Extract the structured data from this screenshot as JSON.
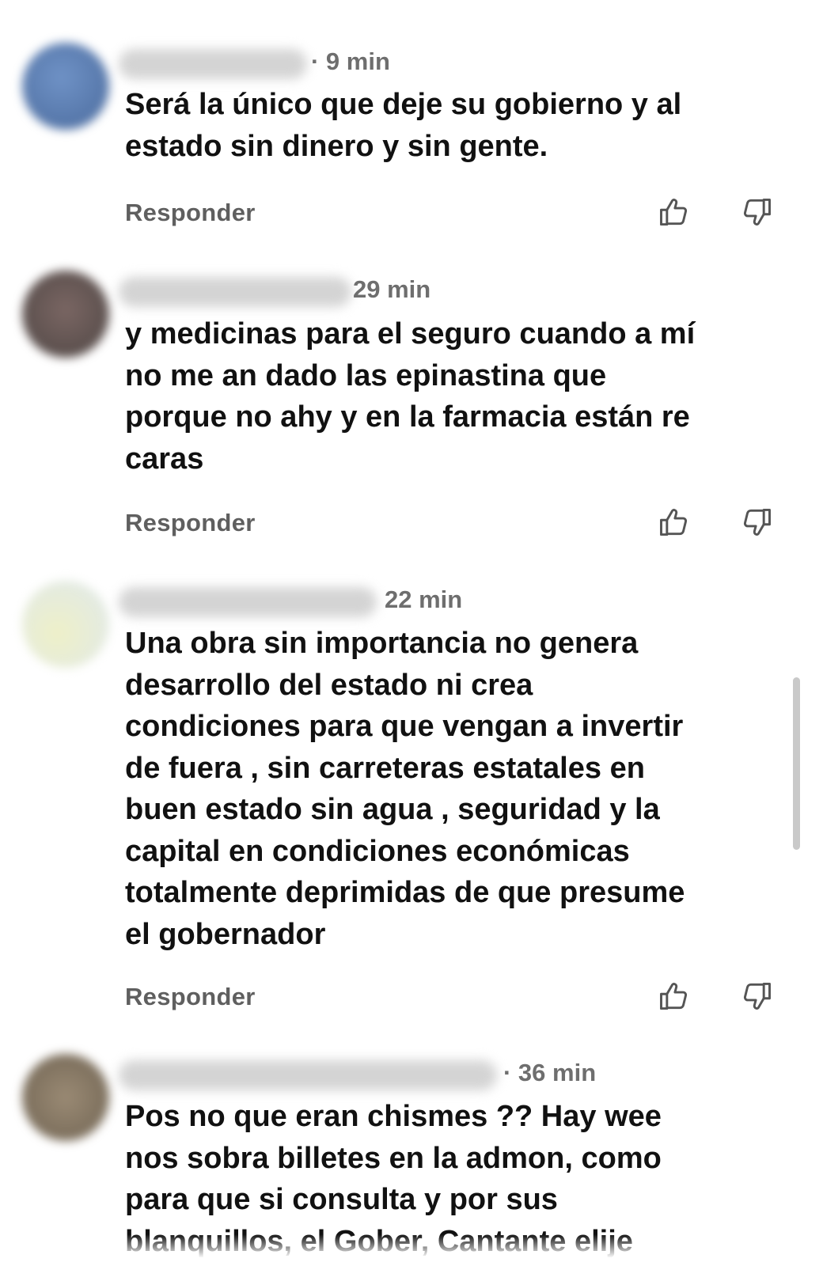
{
  "comments": [
    {
      "time": "· 9 min",
      "lines": [
        "Será la único que deje su gobierno y al",
        "estado sin dinero y sin gente."
      ],
      "reply_label": "Responder",
      "avatar_color": "#5b7fb4"
    },
    {
      "time": "29 min",
      "lines": [
        "y medicinas para el seguro cuando a mí",
        "no me an dado las epinastina que",
        "porque no ahy y en la farmacia están re",
        "caras"
      ],
      "reply_label": "Responder",
      "avatar_color": "#6a5a58"
    },
    {
      "time": "22 min",
      "lines": [
        "Una obra sin importancia no genera",
        "desarrollo del estado ni crea",
        "condiciones para que vengan a invertir",
        "de fuera , sin carreteras estatales en",
        "buen estado sin agua , seguridad y la",
        "capital en condiciones económicas",
        "totalmente deprimidas de que presume",
        "el gobernador"
      ],
      "reply_label": "Responder",
      "avatar_color": "#dfe6cf"
    },
    {
      "time": "· 36 min",
      "lines": [
        "Pos no que eran chismes ?? Hay wee",
        "nos sobra billetes en la admon, como",
        "para que si consulta y por sus",
        "blanquillos, el Gober, Cantante elije"
      ],
      "reply_label": "",
      "avatar_color": "#8a7a66"
    }
  ],
  "icons": {
    "like": "thumbs-up-icon",
    "dislike": "thumbs-down-icon"
  }
}
